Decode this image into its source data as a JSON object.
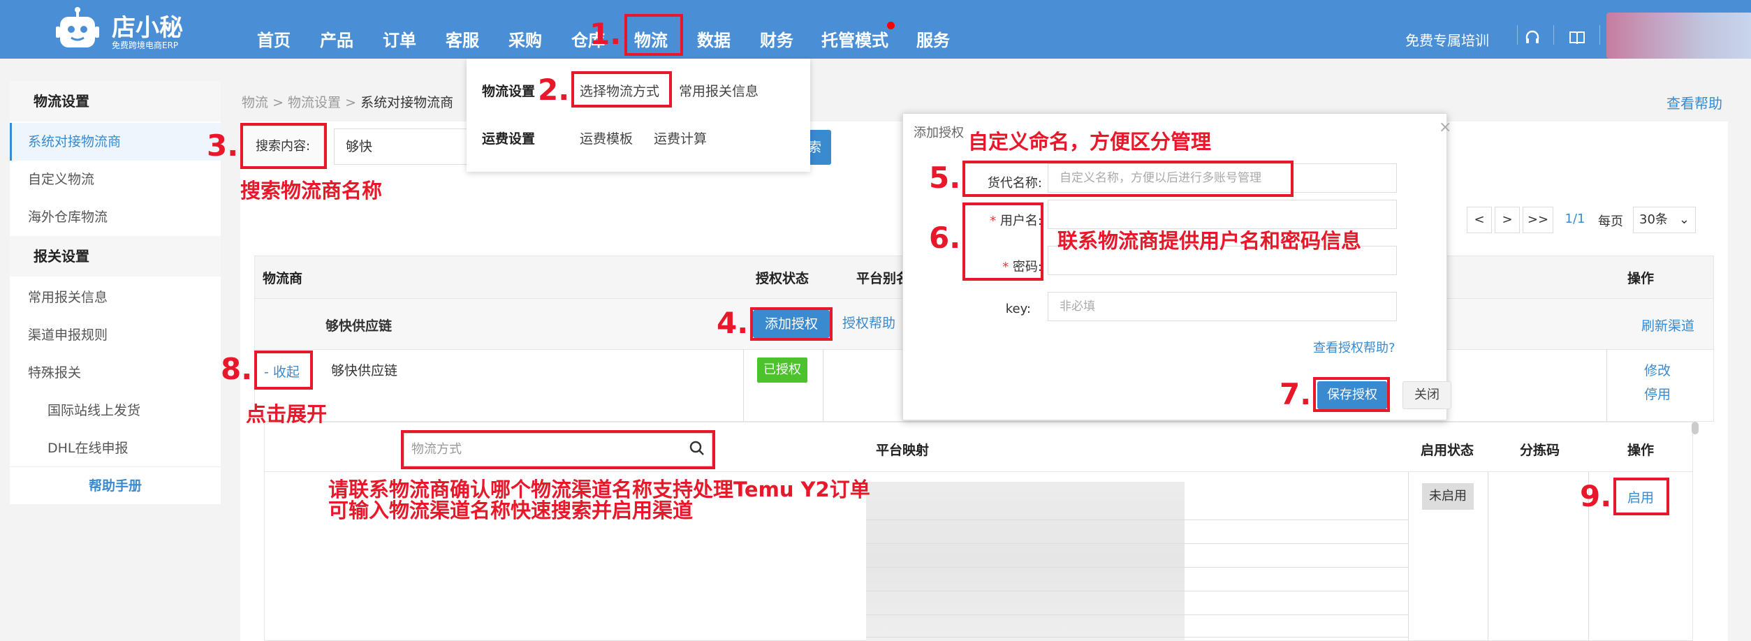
{
  "brand": {
    "name": "店小秘",
    "subtitle": "免费跨境电商ERP"
  },
  "nav": {
    "items": [
      "首页",
      "产品",
      "订单",
      "客服",
      "采购",
      "仓库",
      "物流",
      "数据",
      "财务",
      "托管模式",
      "服务"
    ],
    "training": "免费专属培训"
  },
  "sidebar": {
    "section1": "物流设置",
    "items1": [
      "系统对接物流商",
      "自定义物流",
      "海外仓库物流"
    ],
    "section2": "报关设置",
    "items2": [
      "常用报关信息",
      "渠道申报规则",
      "特殊报关"
    ],
    "subitems": [
      "国际站线上发货",
      "DHL在线申报"
    ],
    "help": "帮助手册"
  },
  "breadcrumb": {
    "p1": "物流",
    "p2": "物流设置",
    "p3": "系统对接物流商",
    "sep": ">"
  },
  "help_link": "查看帮助",
  "dropdown": {
    "label1": "物流设置",
    "item1a": "选择物流方式",
    "item1b": "常用报关信息",
    "label2": "运费设置",
    "item2a": "运费模板",
    "item2b": "运费计算"
  },
  "search": {
    "label": "搜索内容:",
    "value": "够快",
    "button": "索"
  },
  "pager": {
    "first": "<",
    "next": ">",
    "last": ">>",
    "page": "1/1",
    "per_page_label": "每页",
    "per_page": "30条"
  },
  "table": {
    "headers": {
      "carrier": "物流商",
      "auth_status": "授权状态",
      "alias": "平台别名",
      "ops": "操作"
    },
    "group_name": "够快供应链",
    "add_auth": "添加授权",
    "auth_help": "授权帮助",
    "refresh": "刷新渠道",
    "collapse": "- 收起",
    "row_name": "够快供应链",
    "authorized": "已授权",
    "edit": "修改",
    "disable": "停用"
  },
  "sub_table": {
    "search_placeholder": "物流方式",
    "mapping": "平台映射",
    "status": "启用状态",
    "sort_code": "分拣码",
    "ops": "操作",
    "status_value": "未启用",
    "enable": "启用"
  },
  "modal": {
    "title": "添加授权",
    "close": "×",
    "label_name": "货代名称:",
    "placeholder_name": "自定义名称，方便以后进行多账号管理",
    "label_user": "用户名:",
    "label_pwd": "密码:",
    "label_key": "key:",
    "placeholder_key": "非必填",
    "help": "查看授权帮助?",
    "save": "保存授权",
    "cancel": "关闭",
    "required_mark": "*"
  },
  "annotations": {
    "n1": "1.",
    "n2": "2.",
    "n3": "3.",
    "n4": "4.",
    "n5": "5.",
    "n6": "6.",
    "n7": "7.",
    "n8": "8.",
    "n9": "9.",
    "note3": "搜索物流商名称",
    "note5": "自定义命名，方便区分管理",
    "note6": "联系物流商提供用户名和密码信息",
    "note8": "点击展开",
    "note_sub1": "请联系物流商确认哪个物流渠道名称支持处理Temu Y2订单",
    "note_sub2": "可输入物流渠道名称快速搜索并启用渠道"
  }
}
